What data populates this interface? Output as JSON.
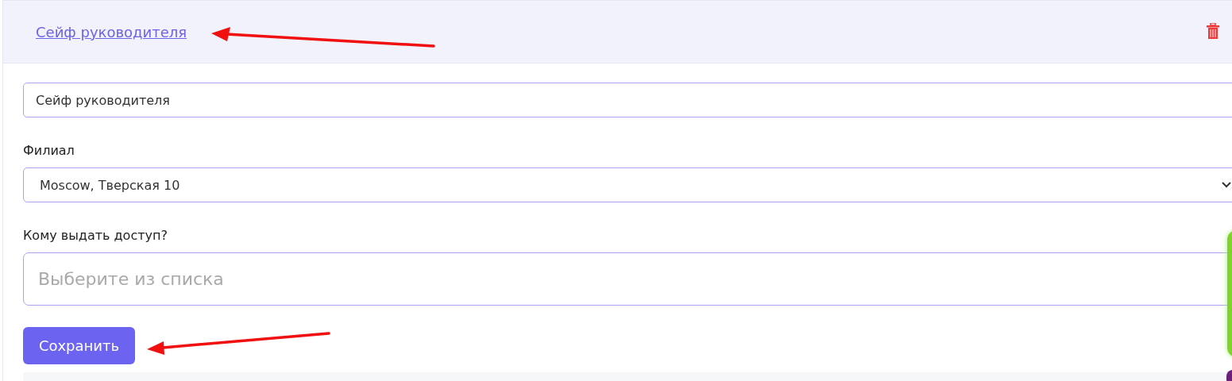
{
  "card": {
    "title": "Сейф руководителя"
  },
  "form": {
    "name_field": {
      "value": "Сейф руководителя"
    },
    "branch": {
      "label": "Филиал",
      "value": "Moscow, Тверская 10"
    },
    "access": {
      "label": "Кому выдать доступ?",
      "placeholder": "Выберите из списка"
    },
    "save_button": "Сохранить"
  }
}
